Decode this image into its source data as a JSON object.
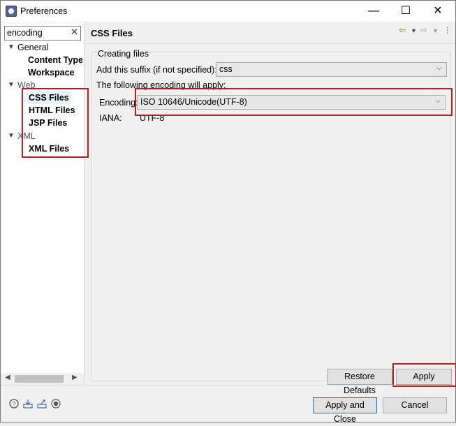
{
  "window": {
    "title": "Preferences"
  },
  "search": {
    "value": "encoding",
    "clear_glyph": "✕"
  },
  "tree": {
    "general_label": "General",
    "content_types_label": "Content Types",
    "workspace_label": "Workspace",
    "web_label": "Web",
    "css_files_label": "CSS Files",
    "html_files_label": "HTML Files",
    "jsp_files_label": "JSP Files",
    "xml_label": "XML",
    "xml_files_label": "XML Files"
  },
  "page": {
    "title": "CSS Files",
    "creating_files_label": "Creating files",
    "suffix_label": "Add this suffix (if not specified):",
    "suffix_value": "css",
    "encoding_intro": "The following encoding will apply:",
    "encoding_label": "Encoding:",
    "encoding_value": "ISO 10646/Unicode(UTF-8)",
    "iana_label": "IANA:",
    "iana_value": "UTF-8"
  },
  "buttons": {
    "restore_defaults": "Restore Defaults",
    "apply": "Apply",
    "apply_and_close": "Apply and Close",
    "cancel": "Cancel"
  },
  "icons": {
    "back": "back-arrow-icon",
    "forward": "forward-arrow-icon",
    "help": "help-icon",
    "import": "import-icon",
    "export": "export-icon",
    "record": "record-icon"
  },
  "colors": {
    "highlight": "#b21f24",
    "selection": "#e5f1fb",
    "default_button_border": "#0078d7"
  }
}
